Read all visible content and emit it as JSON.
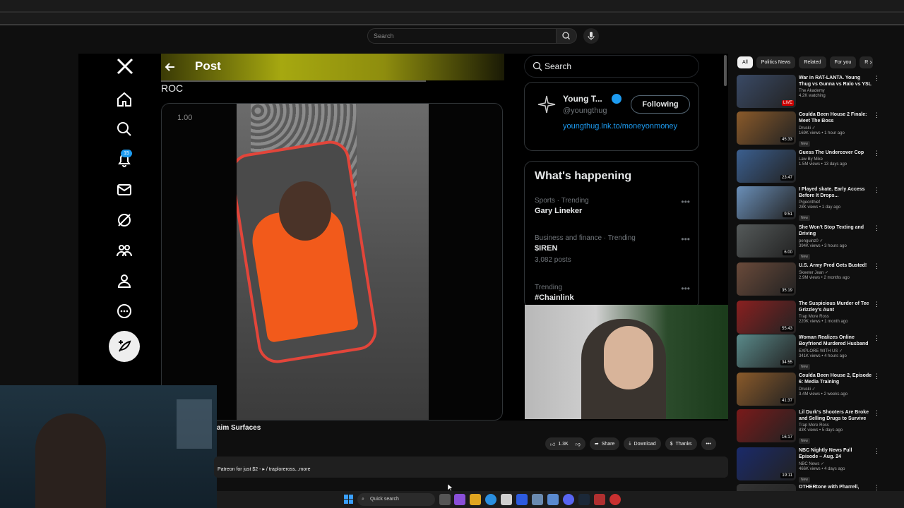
{
  "youtube": {
    "search_placeholder": "Search",
    "video_title": "aim Surfaces",
    "actions": {
      "likes": "1.3K",
      "share": "Share",
      "download": "Download",
      "thanks": "Thanks"
    },
    "description": "Patreon for just $2 - ▸ / traploreross...more",
    "chips": [
      "All",
      "Politics News",
      "Related",
      "For you",
      "R"
    ],
    "recommendations": [
      {
        "title": "War in RAT-LANTA. Young Thug vs Gunna vs Ralo vs YSL ...",
        "channel": "The Akademy",
        "views": "4.2K watching",
        "duration": "LIVE",
        "live": true,
        "thumb": "#3a4a66"
      },
      {
        "title": "Coulda Been House 2 Finale: Meet The Boss",
        "channel": "Druski ✓",
        "views": "169K views • 1 hour ago",
        "badge": "New",
        "duration": "45:33",
        "thumb": "#8a5a2a"
      },
      {
        "title": "Guess The Undercover Cop",
        "channel": "Law By Mike",
        "views": "1.5M views • 13 days ago",
        "duration": "23:47",
        "thumb": "#3b5f8f"
      },
      {
        "title": "I Played skate. Early Access Before It Drops...",
        "channel": "Pigeonthief",
        "views": "28K views • 1 day ago",
        "badge": "New",
        "duration": "9:51",
        "thumb": "#6a8fb8"
      },
      {
        "title": "She Won't Stop Texting and Driving",
        "channel": "penguinz0 ✓",
        "views": "394K views • 3 hours ago",
        "badge": "New",
        "duration": "6:00",
        "thumb": "#555a5a"
      },
      {
        "title": "U.S. Army Pred Gets Busted!",
        "channel": "Skeeter Jean ✓",
        "views": "2.9M views • 2 months ago",
        "duration": "35:19",
        "thumb": "#6a4a3a"
      },
      {
        "title": "The Suspicious Murder of Tee Grizzley's Aunt",
        "channel": "Trap More Ross",
        "views": "220K views • 1 month ago",
        "duration": "55:43",
        "thumb": "#8a2020"
      },
      {
        "title": "Woman Realizes Online Boyfriend Murdered Husband",
        "channel": "EXPLORE WITH US ✓",
        "views": "341K views • 4 hours ago",
        "badge": "New",
        "duration": "34:55",
        "thumb": "#5a8a8a"
      },
      {
        "title": "Coulda Been House 2, Episode 6: Media Training",
        "channel": "Druski ✓",
        "views": "3.4M views • 2 weeks ago",
        "duration": "41:37",
        "thumb": "#8a5a2a"
      },
      {
        "title": "Lil Durk's Shooters Are Broke and Selling Drugs to Survive",
        "channel": "Trap More Ross",
        "views": "83K views • 5 days ago",
        "badge": "New",
        "duration": "16:17",
        "thumb": "#7a1a1a"
      },
      {
        "title": "NBC Nightly News Full Episode – Aug. 24",
        "channel": "NBC News ✓",
        "views": "466K views • 4 days ago",
        "badge": "New",
        "duration": "19:11",
        "thumb": "#1a2a6a"
      },
      {
        "title": "OTHERtone with Pharrell, Scott...",
        "channel": "",
        "views": "",
        "duration": "",
        "thumb": "#333333"
      }
    ]
  },
  "x": {
    "header_title": "Post",
    "post_text": "ROC",
    "speed": "1.00",
    "badge_count": "15",
    "search_label": "Search",
    "profile": {
      "name": "Young T...",
      "handle": "@youngthug",
      "link": "youngthug.lnk.to/moneyonmoney",
      "follow_label": "Following"
    },
    "happening": {
      "title": "What's happening",
      "trends": [
        {
          "meta": "Sports · Trending",
          "topic": "Gary Lineker",
          "count": ""
        },
        {
          "meta": "Business and finance · Trending",
          "topic": "$IREN",
          "count": "3,082 posts"
        },
        {
          "meta": "Trending",
          "topic": "#Chainlink",
          "count": ""
        }
      ]
    }
  },
  "taskbar": {
    "search_label": "Quick search"
  },
  "colors": {
    "x_blue": "#1d9bf0",
    "yt_bg": "#0f0f0f",
    "live_red": "#cc0000"
  }
}
